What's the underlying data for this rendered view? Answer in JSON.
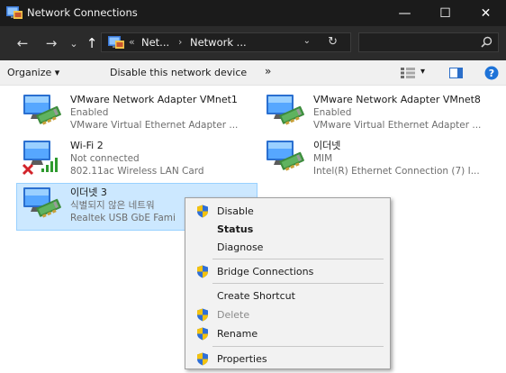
{
  "window": {
    "title": "Network Connections",
    "minimize_glyph": "—",
    "maximize_glyph": "☐",
    "close_glyph": "✕"
  },
  "address": {
    "back_glyph": "←",
    "forward_glyph": "→",
    "history_glyph": "⌄",
    "up_glyph": "↑",
    "prefix": "«",
    "crumb1": "Net...",
    "separator": "›",
    "crumb2": "Network ...",
    "dropdown_glyph": "⌄",
    "refresh_glyph": "↻",
    "search_placeholder": ""
  },
  "commands": {
    "organize": "Organize ▾",
    "disable": "Disable this network device",
    "overflow": "»",
    "view_dropdown": "▾"
  },
  "adapters": [
    {
      "name": "VMware Network Adapter VMnet1",
      "status": "Enabled",
      "device": "VMware Virtual Ethernet Adapter ...",
      "kind": "ethernet"
    },
    {
      "name": "VMware Network Adapter VMnet8",
      "status": "Enabled",
      "device": "VMware Virtual Ethernet Adapter ...",
      "kind": "ethernet"
    },
    {
      "name": "Wi-Fi 2",
      "status": "Not connected",
      "device": "802.11ac Wireless LAN Card",
      "kind": "wifi-disconnected"
    },
    {
      "name": "이더넷",
      "status": "MIM",
      "device": "Intel(R) Ethernet Connection (7) I...",
      "kind": "ethernet"
    },
    {
      "name": "이더넷 3",
      "status": "식별되지 않은 네트워",
      "device": "Realtek USB GbE Fami",
      "kind": "ethernet",
      "selected": true
    }
  ],
  "context_menu": {
    "items": [
      {
        "label": "Disable",
        "shield": true,
        "bold": false,
        "disabled": false
      },
      {
        "label": "Status",
        "shield": false,
        "bold": true,
        "disabled": false
      },
      {
        "label": "Diagnose",
        "shield": false,
        "bold": false,
        "disabled": false
      },
      {
        "label": "Bridge Connections",
        "shield": true,
        "bold": false,
        "disabled": false
      },
      {
        "label": "Create Shortcut",
        "shield": false,
        "bold": false,
        "disabled": false
      },
      {
        "label": "Delete",
        "shield": true,
        "bold": false,
        "disabled": true
      },
      {
        "label": "Rename",
        "shield": true,
        "bold": false,
        "disabled": false
      },
      {
        "label": "Properties",
        "shield": true,
        "bold": false,
        "disabled": false
      }
    ]
  },
  "colors": {
    "titlebar": "#1b1b1b",
    "addressbar": "#2b2b2b",
    "selection": "#cce8ff",
    "shield_blue": "#2f6fd6",
    "shield_yellow": "#f3c20f",
    "help_blue": "#1e73d8",
    "error_red": "#d2232a",
    "signal_green": "#2e9a2e"
  }
}
